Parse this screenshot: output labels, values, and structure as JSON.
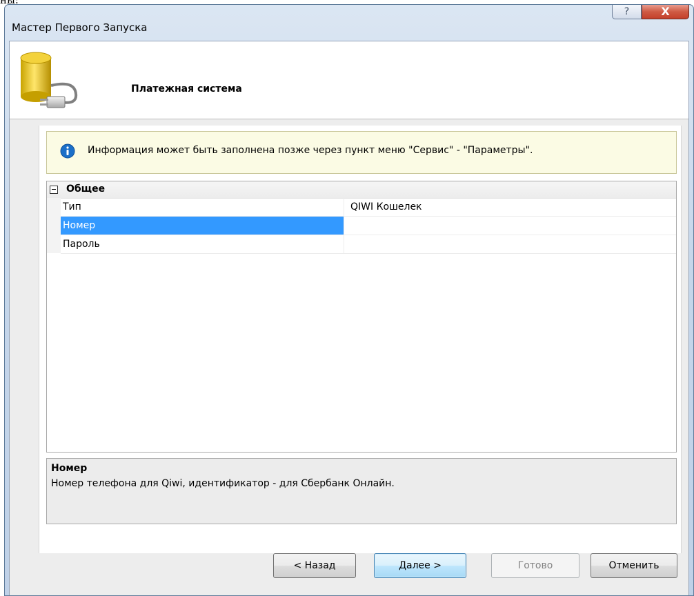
{
  "window": {
    "title": "Мастер Первого Запуска",
    "help_glyph": "?",
    "close_glyph": "X"
  },
  "header": {
    "title": "Платежная система",
    "icon": "database-plug-icon"
  },
  "info": {
    "icon": "info-icon",
    "text": "Информация может быть заполнена позже через пункт меню \"Сервис\" - \"Параметры\"."
  },
  "grid": {
    "category": "Общее",
    "rows": [
      {
        "name": "Тип",
        "value": "QIWI Кошелек"
      },
      {
        "name": "Номер",
        "value": ""
      },
      {
        "name": "Пароль",
        "value": ""
      }
    ],
    "selected_row": "Номер"
  },
  "description": {
    "title": "Номер",
    "text": "Номер телефона для Qiwi, идентификатор - для Сбербанк Онлайн."
  },
  "buttons": {
    "back": "< Назад",
    "next": "Далее >",
    "finish": "Готово",
    "cancel": "Отменить"
  },
  "colors": {
    "selection": "#3399ff",
    "info_background": "#fbfbe4",
    "info_icon": "#1b6fc8"
  }
}
